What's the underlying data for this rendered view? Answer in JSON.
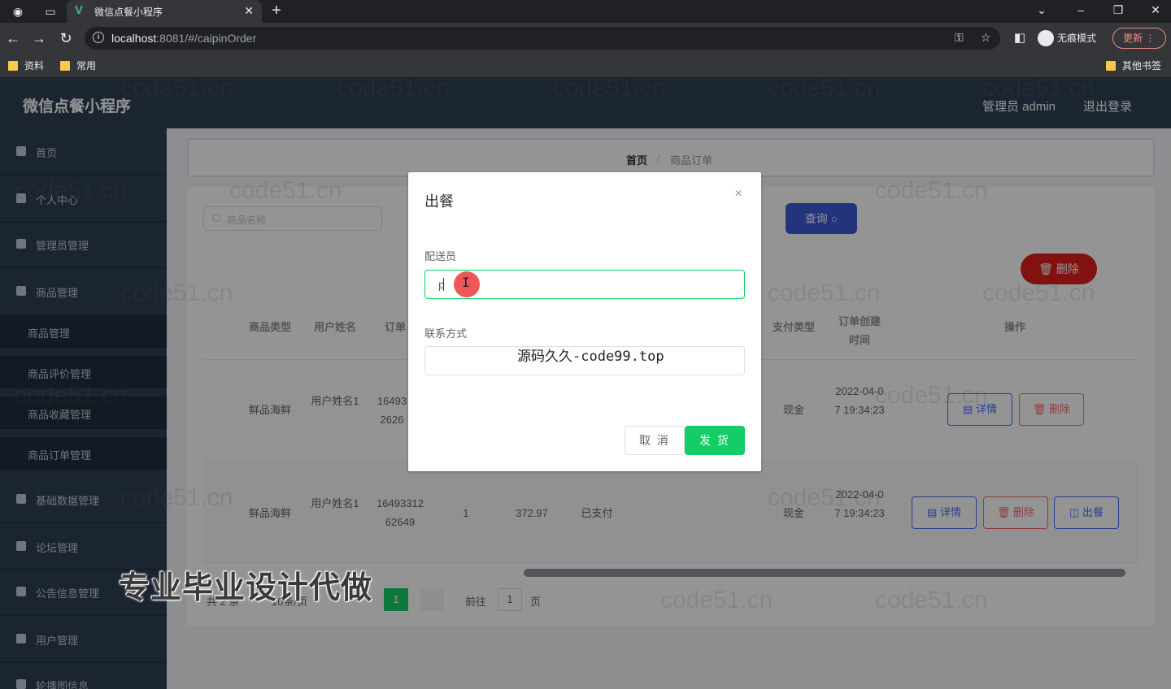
{
  "browser": {
    "tab_title": "微信点餐小程序",
    "url_host": "localhost",
    "url_rest": ":8081/#/caipinOrder",
    "incognito_label": "无痕模式",
    "update_label": "更新",
    "bookmarks": [
      "资料",
      "常用"
    ],
    "other_bookmarks": "其他书签"
  },
  "header": {
    "app_title": "微信点餐小程序",
    "user": "管理员 admin",
    "logout": "退出登录"
  },
  "sidebar": {
    "items": [
      "首页",
      "个人中心",
      "管理员管理",
      "商品管理",
      "基础数据管理",
      "论坛管理",
      "公告信息管理",
      "用户管理",
      "轮播图信息"
    ],
    "sub_items": [
      "商品管理",
      "商品评价管理",
      "商品收藏管理",
      "商品订单管理"
    ]
  },
  "breadcrumb": {
    "home": "首页",
    "sep": "/",
    "current": "商品订单"
  },
  "search": {
    "placeholder": "商品名称",
    "query_label": "查询 ○",
    "bulk_delete_label": "删除"
  },
  "table": {
    "headers": [
      "商品类型",
      "用户姓名",
      "订单",
      "支付类型",
      "订单创建时间",
      "操作"
    ],
    "rows": [
      {
        "type": "鲜品海鲜",
        "user": "用户姓名1",
        "order_no": "16493 2626",
        "pay_type": "现金",
        "created": "2022-04-07 19:34:23",
        "ops": [
          "详情",
          "删除"
        ]
      },
      {
        "type": "鲜品海鲜",
        "user": "用户姓名1",
        "order_no": "1649331262649",
        "count": "1",
        "amount": "372.97",
        "status": "已支付",
        "pay_type": "现金",
        "created": "2022-04-07 19:34:23",
        "ops": [
          "详情",
          "删除",
          "出餐"
        ]
      }
    ]
  },
  "pagination": {
    "total": "共 2 条",
    "page_size": "10条/页",
    "current": "1",
    "goto": "前往",
    "page_input": "1",
    "page_unit": "页"
  },
  "dialog": {
    "title": "出餐",
    "close": "×",
    "courier_label": "配送员",
    "courier_value": "p",
    "contact_label": "联系方式",
    "contact_value": "",
    "cancel": "取 消",
    "confirm": "发 货"
  },
  "overlay_text": {
    "source_note": "源码久久-code99.top",
    "promo": "专业毕业设计代做",
    "watermark": "code51.cn"
  },
  "colors": {
    "accent": "#13ce66",
    "primary": "#3f5bd6",
    "danger": "#e02020",
    "sidebar": "#304156"
  }
}
